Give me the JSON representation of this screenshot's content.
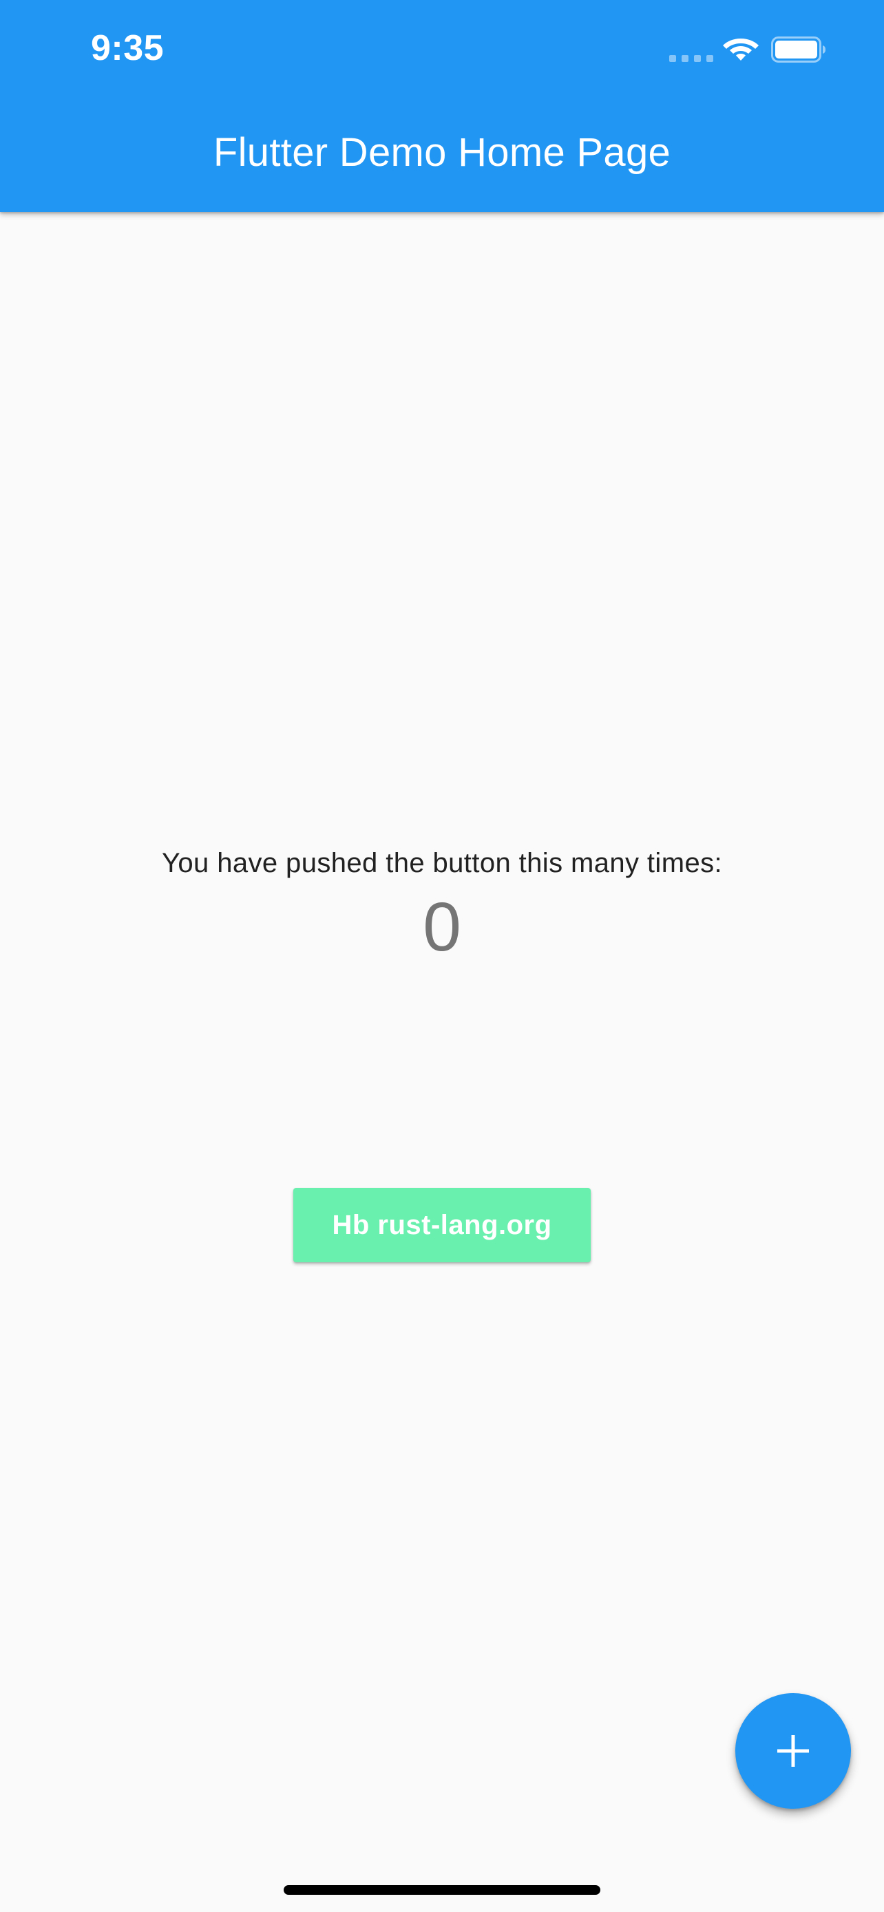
{
  "status_bar": {
    "time": "9:35",
    "signal_icon": "cellular-signal-icon",
    "wifi_icon": "wifi-icon",
    "battery_icon": "battery-icon"
  },
  "app_bar": {
    "title": "Flutter Demo Home Page",
    "background_color": "#2196f3"
  },
  "body": {
    "counter_label": "You have pushed the button this many times:",
    "counter_value": "0",
    "link_button": {
      "label": "Hb rust-lang.org",
      "background_color": "#69f0ae"
    }
  },
  "fab": {
    "icon": "plus-icon",
    "background_color": "#2196f3"
  }
}
